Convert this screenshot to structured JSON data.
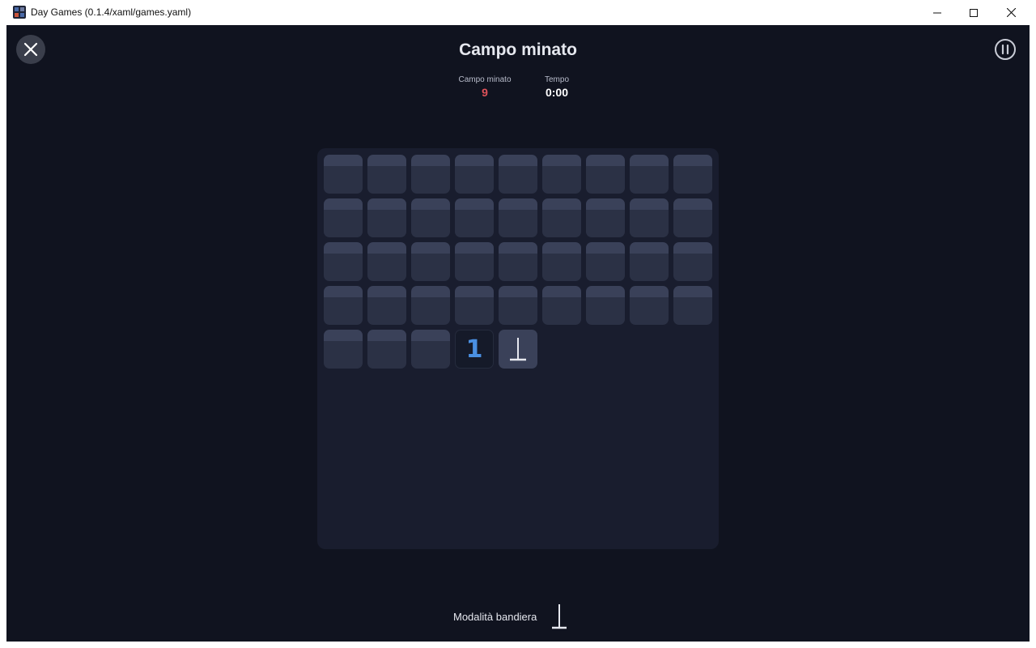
{
  "window": {
    "title": "Day Games (0.1.4/xaml/games.yaml)",
    "controls": [
      "minimize-icon",
      "maximize-icon",
      "close-icon"
    ]
  },
  "header": {
    "title": "Campo minato",
    "close_icon": "close-icon",
    "pause_icon": "pause-icon"
  },
  "stats": {
    "mines_label": "Campo minato",
    "mines_value": "9",
    "time_label": "Tempo",
    "time_value": "0:00"
  },
  "board": {
    "columns": 9,
    "cells": [
      "h",
      "h",
      "h",
      "h",
      "h",
      "h",
      "h",
      "h",
      "h",
      "h",
      "h",
      "h",
      "h",
      "h",
      "h",
      "h",
      "h",
      "h",
      "h",
      "h",
      "h",
      "h",
      "h",
      "h",
      "h",
      "h",
      "h",
      "h",
      "h",
      "h",
      "h",
      "h",
      "h",
      "h",
      "h",
      "h",
      "h",
      "h",
      "h",
      "1",
      "flag"
    ]
  },
  "footer": {
    "flag_mode_label": "Modalità bandiera",
    "flag_icon": "flag-icon"
  },
  "colors": {
    "background": "#10131f",
    "board": "#191d2e",
    "tile": "#2b3145",
    "tile_top": "#3a4159",
    "mine_count": "#e0525a",
    "number_one": "#4a90e2"
  }
}
